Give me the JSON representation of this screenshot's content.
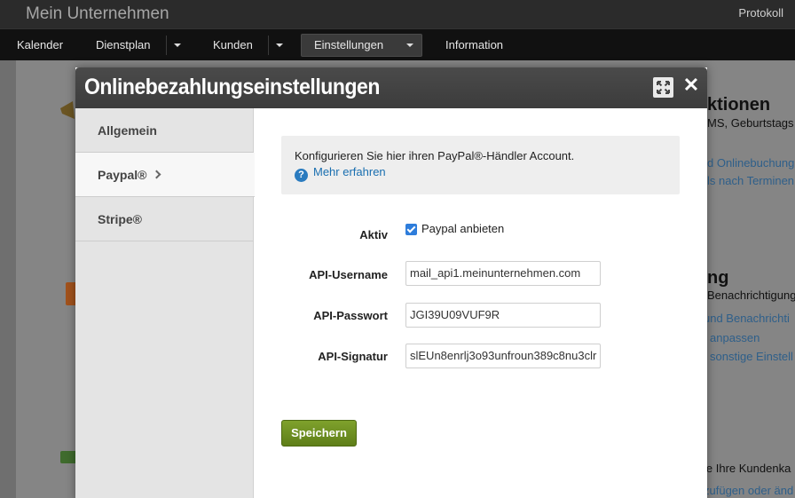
{
  "app": {
    "title": "Mein Unternehmen",
    "protokoll": "Protokoll"
  },
  "nav": {
    "items": [
      {
        "label": "Kalender"
      },
      {
        "label": "Dienstplan"
      },
      {
        "label": "Kunden"
      },
      {
        "label": "Einstellungen"
      },
      {
        "label": "Information"
      }
    ],
    "active": "Einstellungen"
  },
  "background": {
    "heading1": "ktionen",
    "text1": "MS, Geburtstags",
    "link1": "d Onlinebuchung",
    "link2": "ls nach Terminen",
    "heading2": "ng",
    "text2": "Benachrichtigung",
    "link3": "und Benachrichti",
    "link4": "anpassen",
    "link5": "sonstige Einstell",
    "text3": "ie Ihre Kundenka",
    "link6": "zufügen oder änd"
  },
  "modal": {
    "title": "Onlinebezahlungseinstellungen",
    "close": "✕",
    "tabs": [
      {
        "label": "Allgemein"
      },
      {
        "label": "Paypal®"
      },
      {
        "label": "Stripe®"
      }
    ],
    "active_tab": "Paypal®",
    "info": {
      "text": "Konfigurieren Sie hier ihren PayPal®-Händler Account.",
      "help_icon": "?",
      "link": "Mehr erfahren"
    },
    "form": {
      "aktiv_label": "Aktiv",
      "aktiv_checked": true,
      "aktiv_option": "Paypal anbieten",
      "username_label": "API-Username",
      "username_value": "mail_api1.meinunternehmen.com",
      "password_label": "API-Passwort",
      "password_value": "JGI39U09VUF9R",
      "signature_label": "API-Signatur",
      "signature_value": "slEUn8enrlj3o93unfroun389c8nu3clr"
    },
    "save_label": "Speichern"
  },
  "colors": {
    "accent_link": "#1a6fb0",
    "save_button": "#6b8c1f",
    "header_bg": "#2b2b2b"
  }
}
